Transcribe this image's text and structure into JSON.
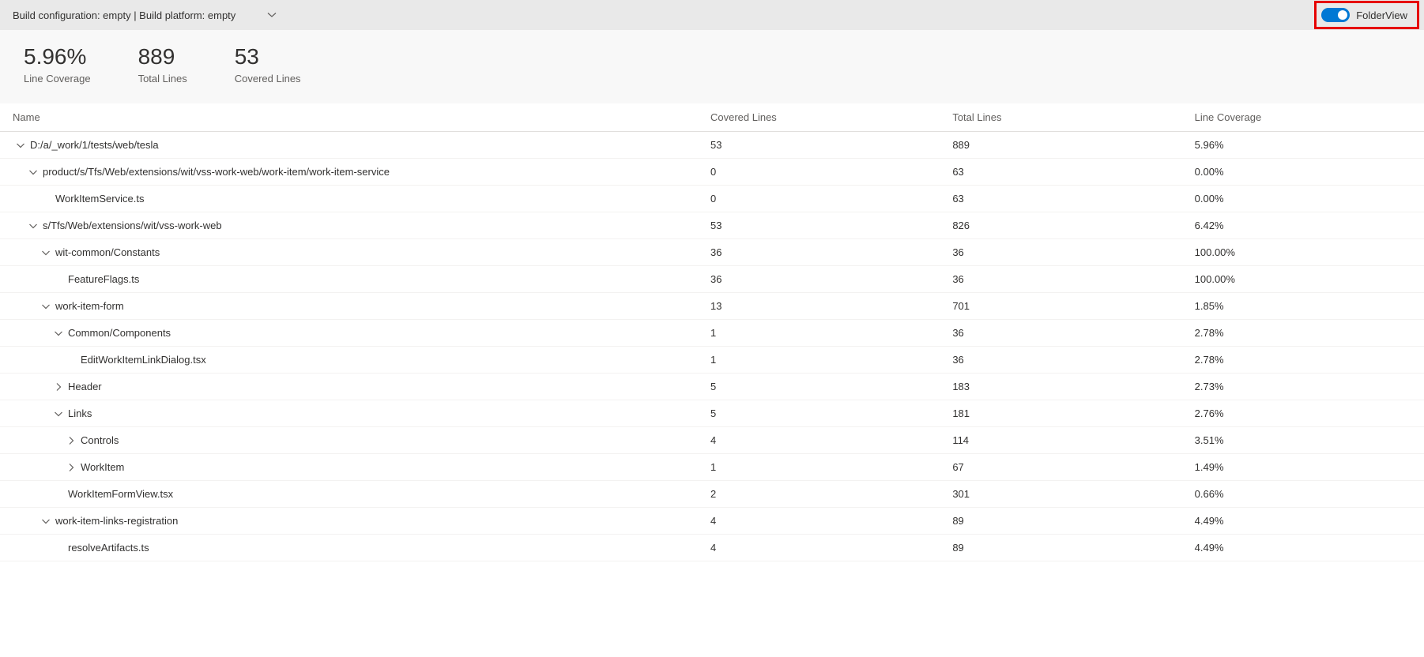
{
  "topbar": {
    "build_config_text": "Build configuration: empty | Build platform: empty",
    "folder_view_label": "FolderView"
  },
  "summary": [
    {
      "value": "5.96%",
      "label": "Line Coverage"
    },
    {
      "value": "889",
      "label": "Total Lines"
    },
    {
      "value": "53",
      "label": "Covered Lines"
    }
  ],
  "table": {
    "headers": {
      "name": "Name",
      "covered": "Covered Lines",
      "total": "Total Lines",
      "coverage": "Line Coverage"
    },
    "rows": [
      {
        "indent": 0,
        "icon": "down",
        "name": "D:/a/_work/1/tests/web/tesla",
        "covered": "53",
        "total": "889",
        "coverage": "5.96%"
      },
      {
        "indent": 1,
        "icon": "down",
        "name": "product/s/Tfs/Web/extensions/wit/vss-work-web/work-item/work-item-service",
        "covered": "0",
        "total": "63",
        "coverage": "0.00%"
      },
      {
        "indent": 2,
        "icon": "none",
        "name": "WorkItemService.ts",
        "covered": "0",
        "total": "63",
        "coverage": "0.00%"
      },
      {
        "indent": 1,
        "icon": "down",
        "name": "s/Tfs/Web/extensions/wit/vss-work-web",
        "covered": "53",
        "total": "826",
        "coverage": "6.42%"
      },
      {
        "indent": 2,
        "icon": "down",
        "name": "wit-common/Constants",
        "covered": "36",
        "total": "36",
        "coverage": "100.00%"
      },
      {
        "indent": 3,
        "icon": "none",
        "name": "FeatureFlags.ts",
        "covered": "36",
        "total": "36",
        "coverage": "100.00%"
      },
      {
        "indent": 2,
        "icon": "down",
        "name": "work-item-form",
        "covered": "13",
        "total": "701",
        "coverage": "1.85%"
      },
      {
        "indent": 3,
        "icon": "down",
        "name": "Common/Components",
        "covered": "1",
        "total": "36",
        "coverage": "2.78%"
      },
      {
        "indent": 4,
        "icon": "none",
        "name": "EditWorkItemLinkDialog.tsx",
        "covered": "1",
        "total": "36",
        "coverage": "2.78%"
      },
      {
        "indent": 3,
        "icon": "right",
        "name": "Header",
        "covered": "5",
        "total": "183",
        "coverage": "2.73%"
      },
      {
        "indent": 3,
        "icon": "down",
        "name": "Links",
        "covered": "5",
        "total": "181",
        "coverage": "2.76%"
      },
      {
        "indent": 4,
        "icon": "right",
        "name": "Controls",
        "covered": "4",
        "total": "114",
        "coverage": "3.51%"
      },
      {
        "indent": 4,
        "icon": "right",
        "name": "WorkItem",
        "covered": "1",
        "total": "67",
        "coverage": "1.49%"
      },
      {
        "indent": 3,
        "icon": "none",
        "name": "WorkItemFormView.tsx",
        "covered": "2",
        "total": "301",
        "coverage": "0.66%"
      },
      {
        "indent": 2,
        "icon": "down",
        "name": "work-item-links-registration",
        "covered": "4",
        "total": "89",
        "coverage": "4.49%"
      },
      {
        "indent": 3,
        "icon": "none",
        "name": "resolveArtifacts.ts",
        "covered": "4",
        "total": "89",
        "coverage": "4.49%"
      }
    ]
  },
  "icons": {
    "chevron_down": "chevron-down-icon",
    "chevron_right": "chevron-right-icon"
  }
}
